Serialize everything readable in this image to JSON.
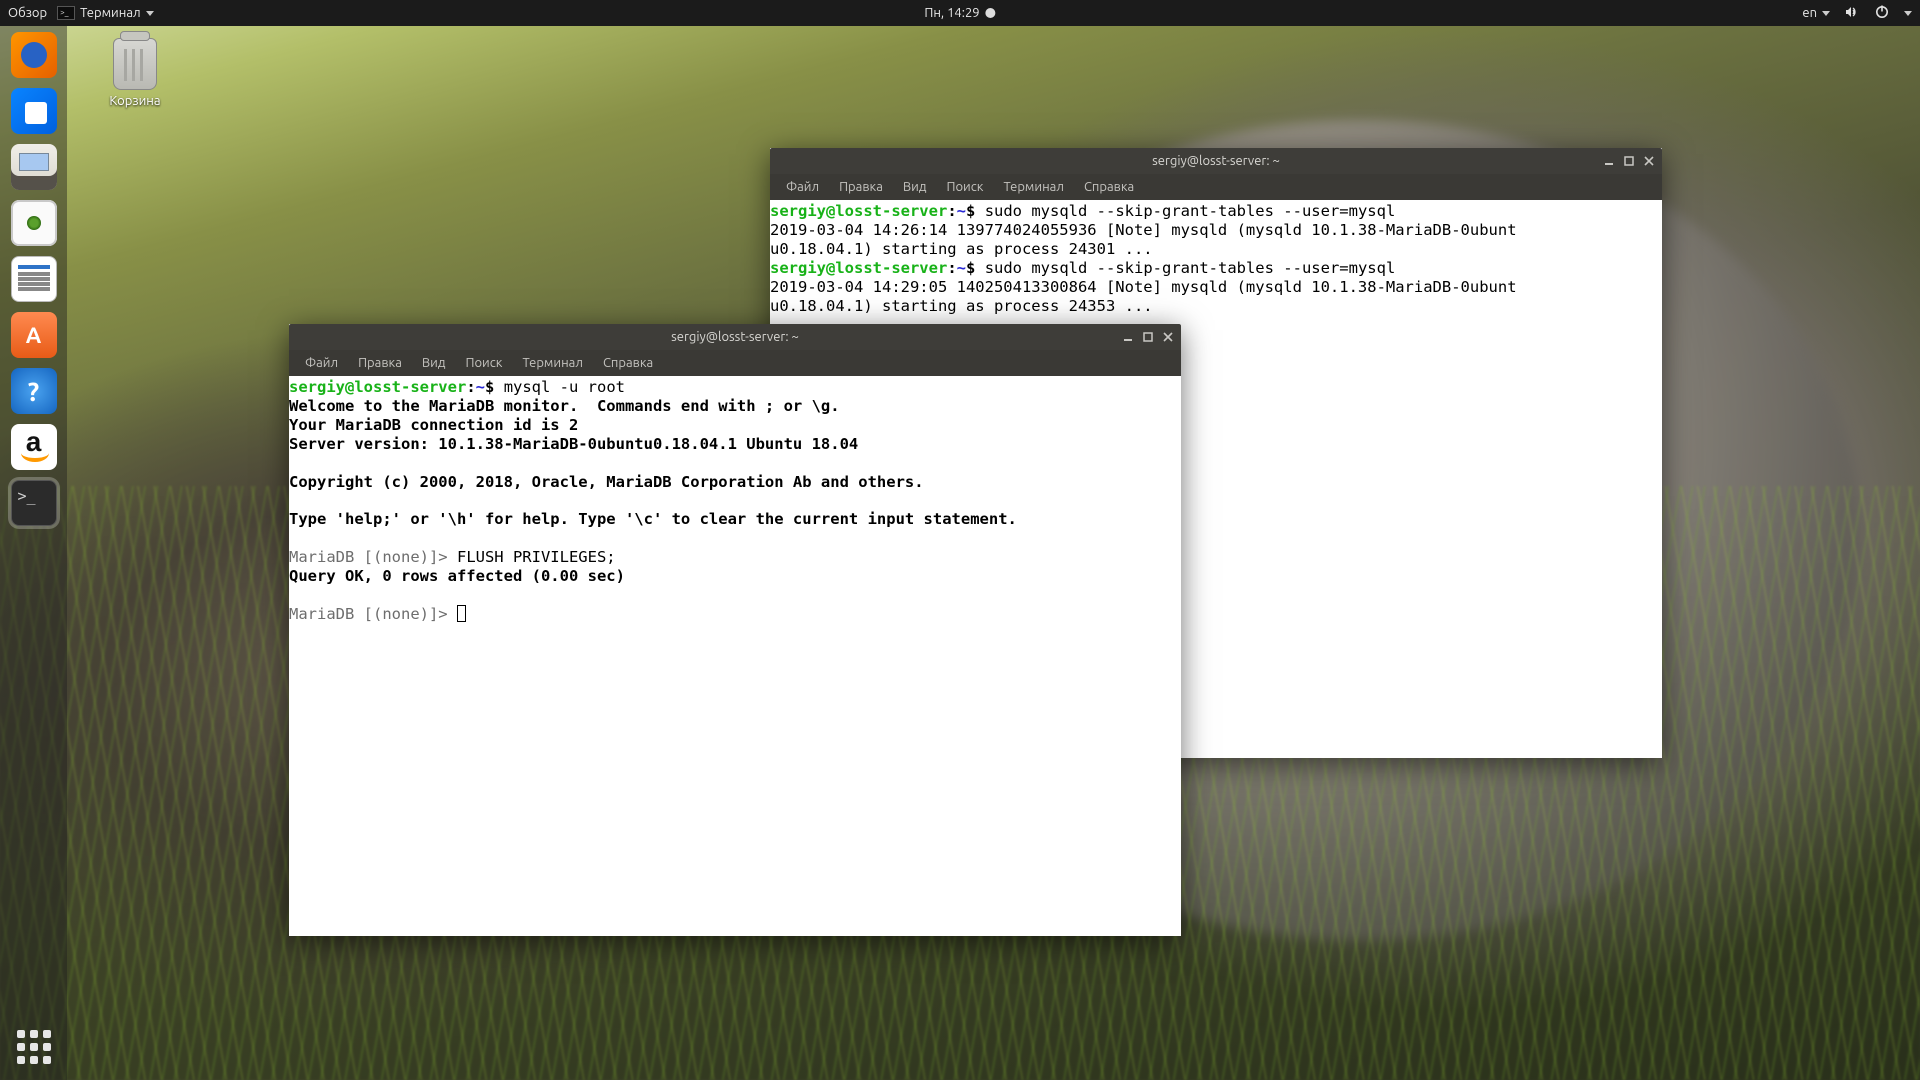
{
  "topbar": {
    "activities": "Обзор",
    "app_menu": "Терминал",
    "clock": "Пн, 14:29",
    "lang": "en"
  },
  "desktop": {
    "trash_label": "Корзина"
  },
  "dock": {
    "items": [
      {
        "name": "firefox"
      },
      {
        "name": "thunderbird"
      },
      {
        "name": "files"
      },
      {
        "name": "rhythmbox"
      },
      {
        "name": "writer"
      },
      {
        "name": "software"
      },
      {
        "name": "help"
      },
      {
        "name": "amazon"
      },
      {
        "name": "terminal"
      }
    ]
  },
  "menu": {
    "file": "Файл",
    "edit": "Правка",
    "view": "Вид",
    "search": "Поиск",
    "terminal": "Терминал",
    "help": "Справка"
  },
  "back_window": {
    "title": "sergiy@losst-server: ~",
    "prompt": {
      "userhost": "sergiy@losst-server",
      "path": "~",
      "sigil": "$"
    },
    "cmd1": "sudo mysqld --skip-grant-tables --user=mysql",
    "out1a": "2019-03-04 14:26:14 139774024055936 [Note] mysqld (mysqld 10.1.38-MariaDB-0ubunt",
    "out1b": "u0.18.04.1) starting as process 24301 ...",
    "cmd2": "sudo mysqld --skip-grant-tables --user=mysql",
    "out2a": "2019-03-04 14:29:05 140250413300864 [Note] mysqld (mysqld 10.1.38-MariaDB-0ubunt",
    "out2b": "u0.18.04.1) starting as process 24353 ..."
  },
  "front_window": {
    "title": "sergiy@losst-server: ~",
    "prompt": {
      "userhost": "sergiy@losst-server",
      "path": "~",
      "sigil": "$"
    },
    "cmd": "mysql -u root",
    "welcome1": "Welcome to the MariaDB monitor.  Commands end with ; or \\g.",
    "welcome2": "Your MariaDB connection id is 2",
    "welcome3": "Server version: 10.1.38-MariaDB-0ubuntu0.18.04.1 Ubuntu 18.04",
    "copyright": "Copyright (c) 2000, 2018, Oracle, MariaDB Corporation Ab and others.",
    "helpline": "Type 'help;' or '\\h' for help. Type '\\c' to clear the current input statement.",
    "db_prompt": "MariaDB [(none)]> ",
    "stmt1": "FLUSH PRIVILEGES;",
    "stmt1_result": "Query OK, 0 rows affected (0.00 sec)"
  }
}
